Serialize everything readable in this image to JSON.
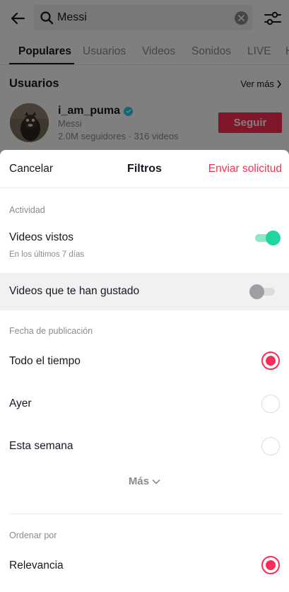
{
  "search": {
    "query": "Messi"
  },
  "tabs": [
    {
      "label": "Populares"
    },
    {
      "label": "Usuarios"
    },
    {
      "label": "Videos"
    },
    {
      "label": "Sonidos"
    },
    {
      "label": "LIVE"
    },
    {
      "label": "H"
    }
  ],
  "users_section": {
    "title": "Usuarios",
    "see_more": "Ver más",
    "user": {
      "username": "i_am_puma",
      "name": "Messi",
      "stats": "2.0M seguidores · 316 videos",
      "follow_label": "Seguir"
    }
  },
  "sheet": {
    "cancel_label": "Cancelar",
    "title": "Filtros",
    "submit_label": "Enviar solicitud",
    "activity": {
      "label": "Actividad",
      "watched": {
        "label": "Videos vistos",
        "sub": "En los últimos 7 días",
        "on": true
      },
      "liked": {
        "label": "Videos que te han gustado",
        "on": false
      }
    },
    "date": {
      "label": "Fecha de publicación",
      "options": [
        {
          "label": "Todo el tiempo",
          "selected": true
        },
        {
          "label": "Ayer",
          "selected": false
        },
        {
          "label": "Esta semana",
          "selected": false
        }
      ],
      "more_label": "Más"
    },
    "sort": {
      "label": "Ordenar por",
      "options": [
        {
          "label": "Relevancia",
          "selected": true
        }
      ]
    }
  },
  "colors": {
    "accent": "#fe2c55",
    "toggle_on": "#20d5a0",
    "verified": "#20d5ec"
  }
}
